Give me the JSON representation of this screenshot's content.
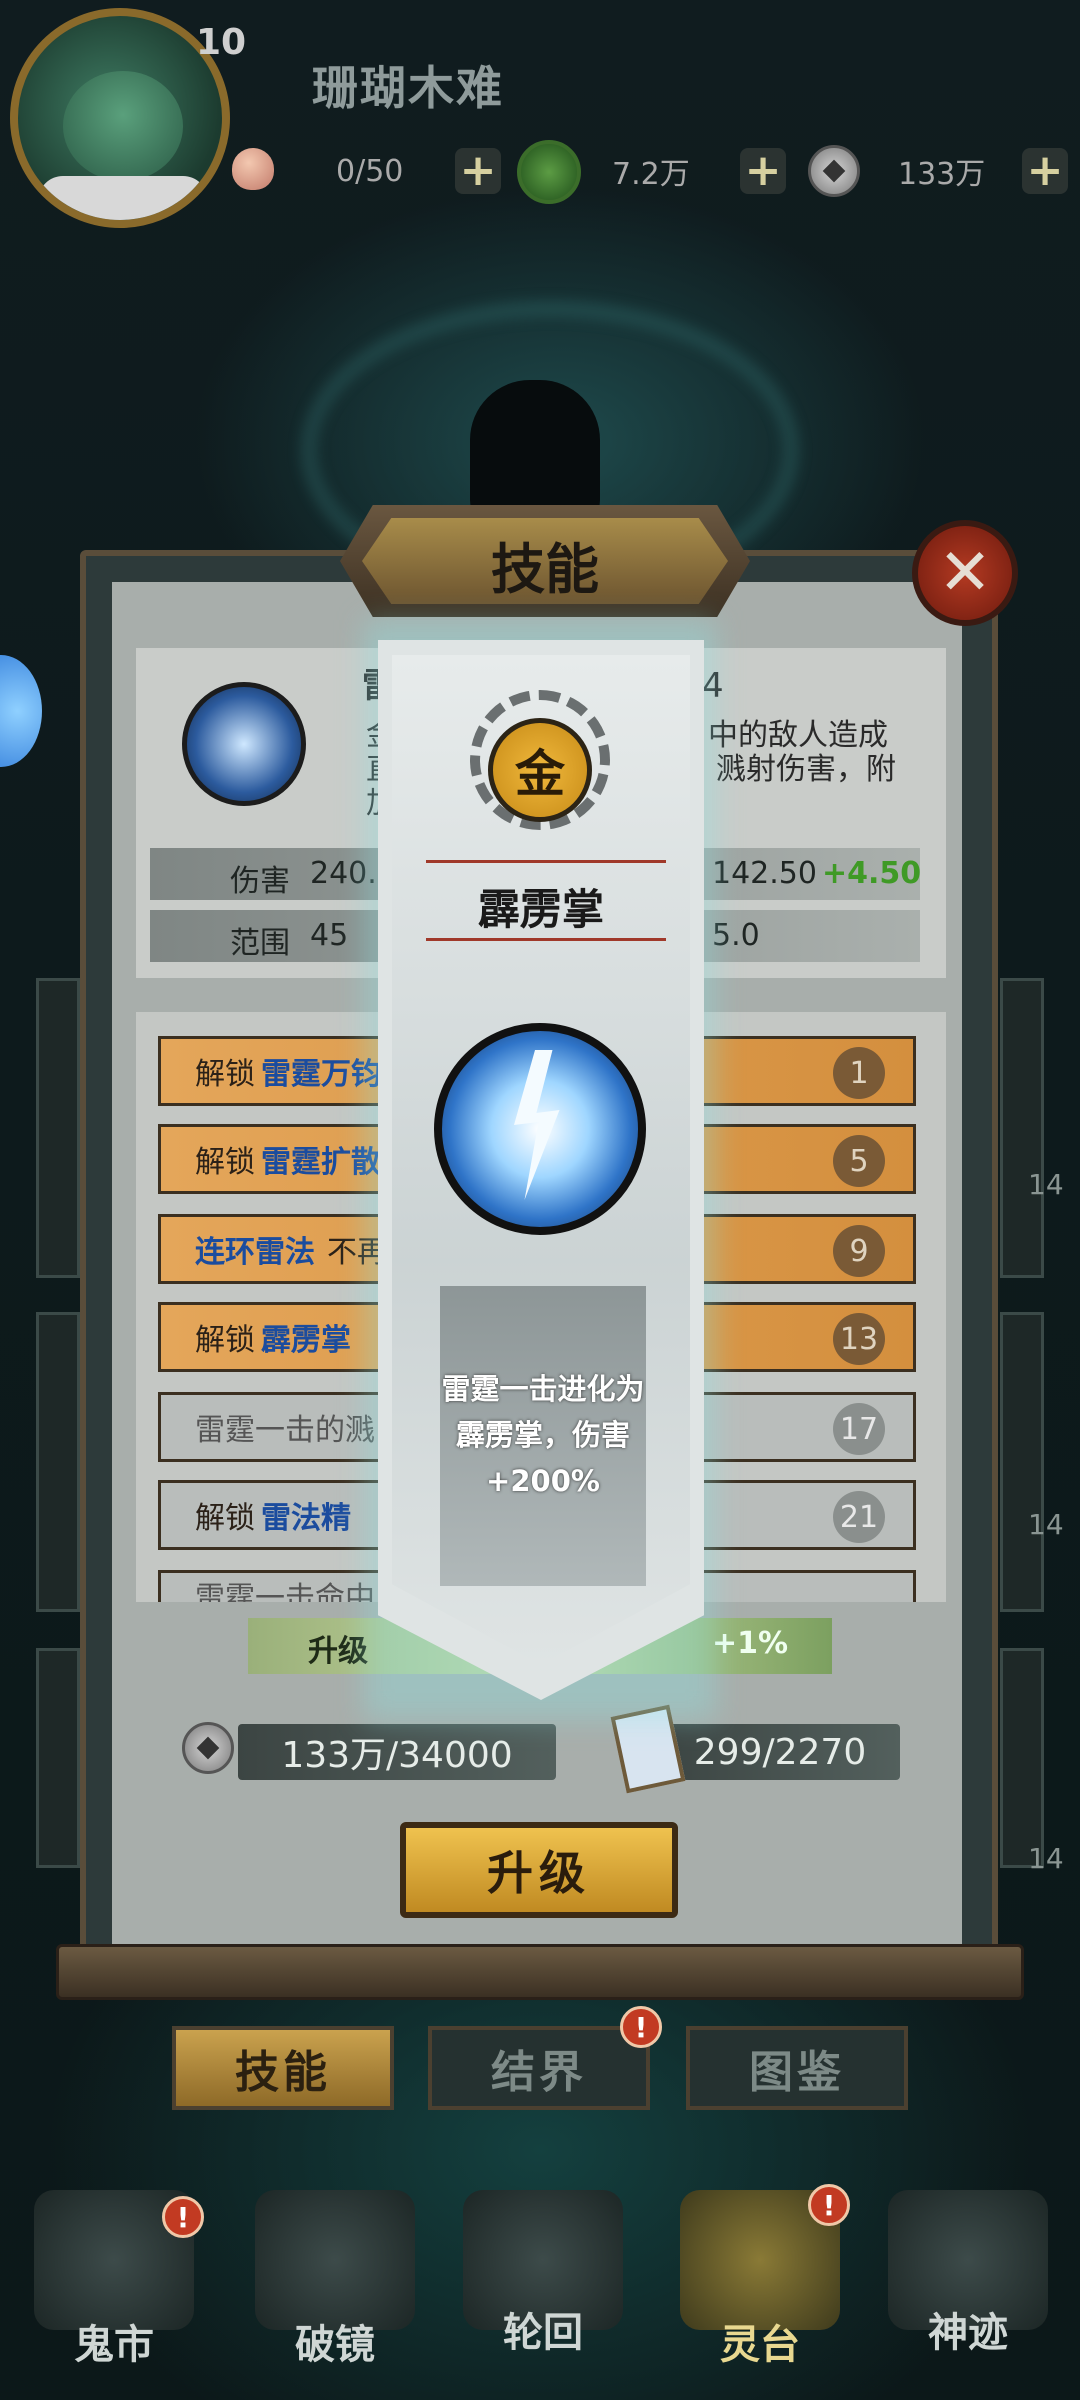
{
  "header": {
    "level": "10",
    "player_name": "珊瑚木难",
    "resources": [
      {
        "icon": "peach-icon",
        "value": "0/50"
      },
      {
        "icon": "jade-icon",
        "value": "7.2万"
      },
      {
        "icon": "coin-icon",
        "value": "133万"
      }
    ],
    "plus": "+"
  },
  "panel": {
    "title": "技能",
    "close": "✕"
  },
  "skill_info": {
    "name_partial": "雷",
    "level_suffix": "4",
    "desc_right_1": "中的敌人造成",
    "desc_right_2": "溅射伤害，附",
    "desc_left_1": "金",
    "desc_left_2": "直",
    "desc_left_3": "加",
    "stats": [
      {
        "label": "伤害",
        "left_value": "240.",
        "right_value": "142.50",
        "bonus": "+4.50"
      },
      {
        "label": "范围",
        "left_value": "45",
        "right_value": "5.0",
        "bonus": ""
      }
    ]
  },
  "unlock_list": [
    {
      "prefix": "解锁",
      "name": "雷霆万钧",
      "rest": "",
      "level": "1",
      "style": "gold"
    },
    {
      "prefix": "解锁",
      "name": "雷霆扩散",
      "rest": "",
      "level": "5",
      "style": "gold"
    },
    {
      "prefix": "",
      "name": "连环雷法",
      "rest": "不再",
      "level": "9",
      "style": "gold"
    },
    {
      "prefix": "解锁",
      "name": "霹雳掌",
      "rest": "",
      "level": "13",
      "style": "gold"
    },
    {
      "prefix": "",
      "name": "",
      "rest": "雷霆一击的溅",
      "level": "17",
      "style": "gray"
    },
    {
      "prefix": "解锁",
      "name": "雷法精",
      "rest": "",
      "level": "21",
      "style": "gray"
    },
    {
      "prefix": "",
      "name": "",
      "rest": "雷霆一击命中",
      "level": "",
      "style": "gray"
    }
  ],
  "upgrade_bar": {
    "label": "升级",
    "percent": "+1%"
  },
  "costs": {
    "coins": "133万/34000",
    "scrolls": "299/2270"
  },
  "upgrade_button": "升级",
  "tabs": [
    {
      "label": "技能",
      "active": true
    },
    {
      "label": "结界",
      "active": false
    },
    {
      "label": "图鉴",
      "active": false
    }
  ],
  "badge_text": "!",
  "nav": [
    {
      "label": "鬼市",
      "icon": "ghost-market-icon"
    },
    {
      "label": "破镜",
      "icon": "broken-mirror-icon"
    },
    {
      "label": "轮回",
      "icon": "yin-yang-icon"
    },
    {
      "label": "灵台",
      "icon": "altar-icon"
    },
    {
      "label": "神迹",
      "icon": "mountain-icon"
    }
  ],
  "banner": {
    "element": "金",
    "skill_name": "霹雳掌",
    "description": "雷霆一击进化为霹雳掌，伤害 +200%"
  },
  "side_levels": [
    "14",
    "14",
    "14"
  ],
  "colors": {
    "accent_gold": "#d48f3e",
    "bonus_green": "#4fae2a",
    "highlight_blue": "#1b4c9e",
    "close_red": "#b43a22"
  }
}
